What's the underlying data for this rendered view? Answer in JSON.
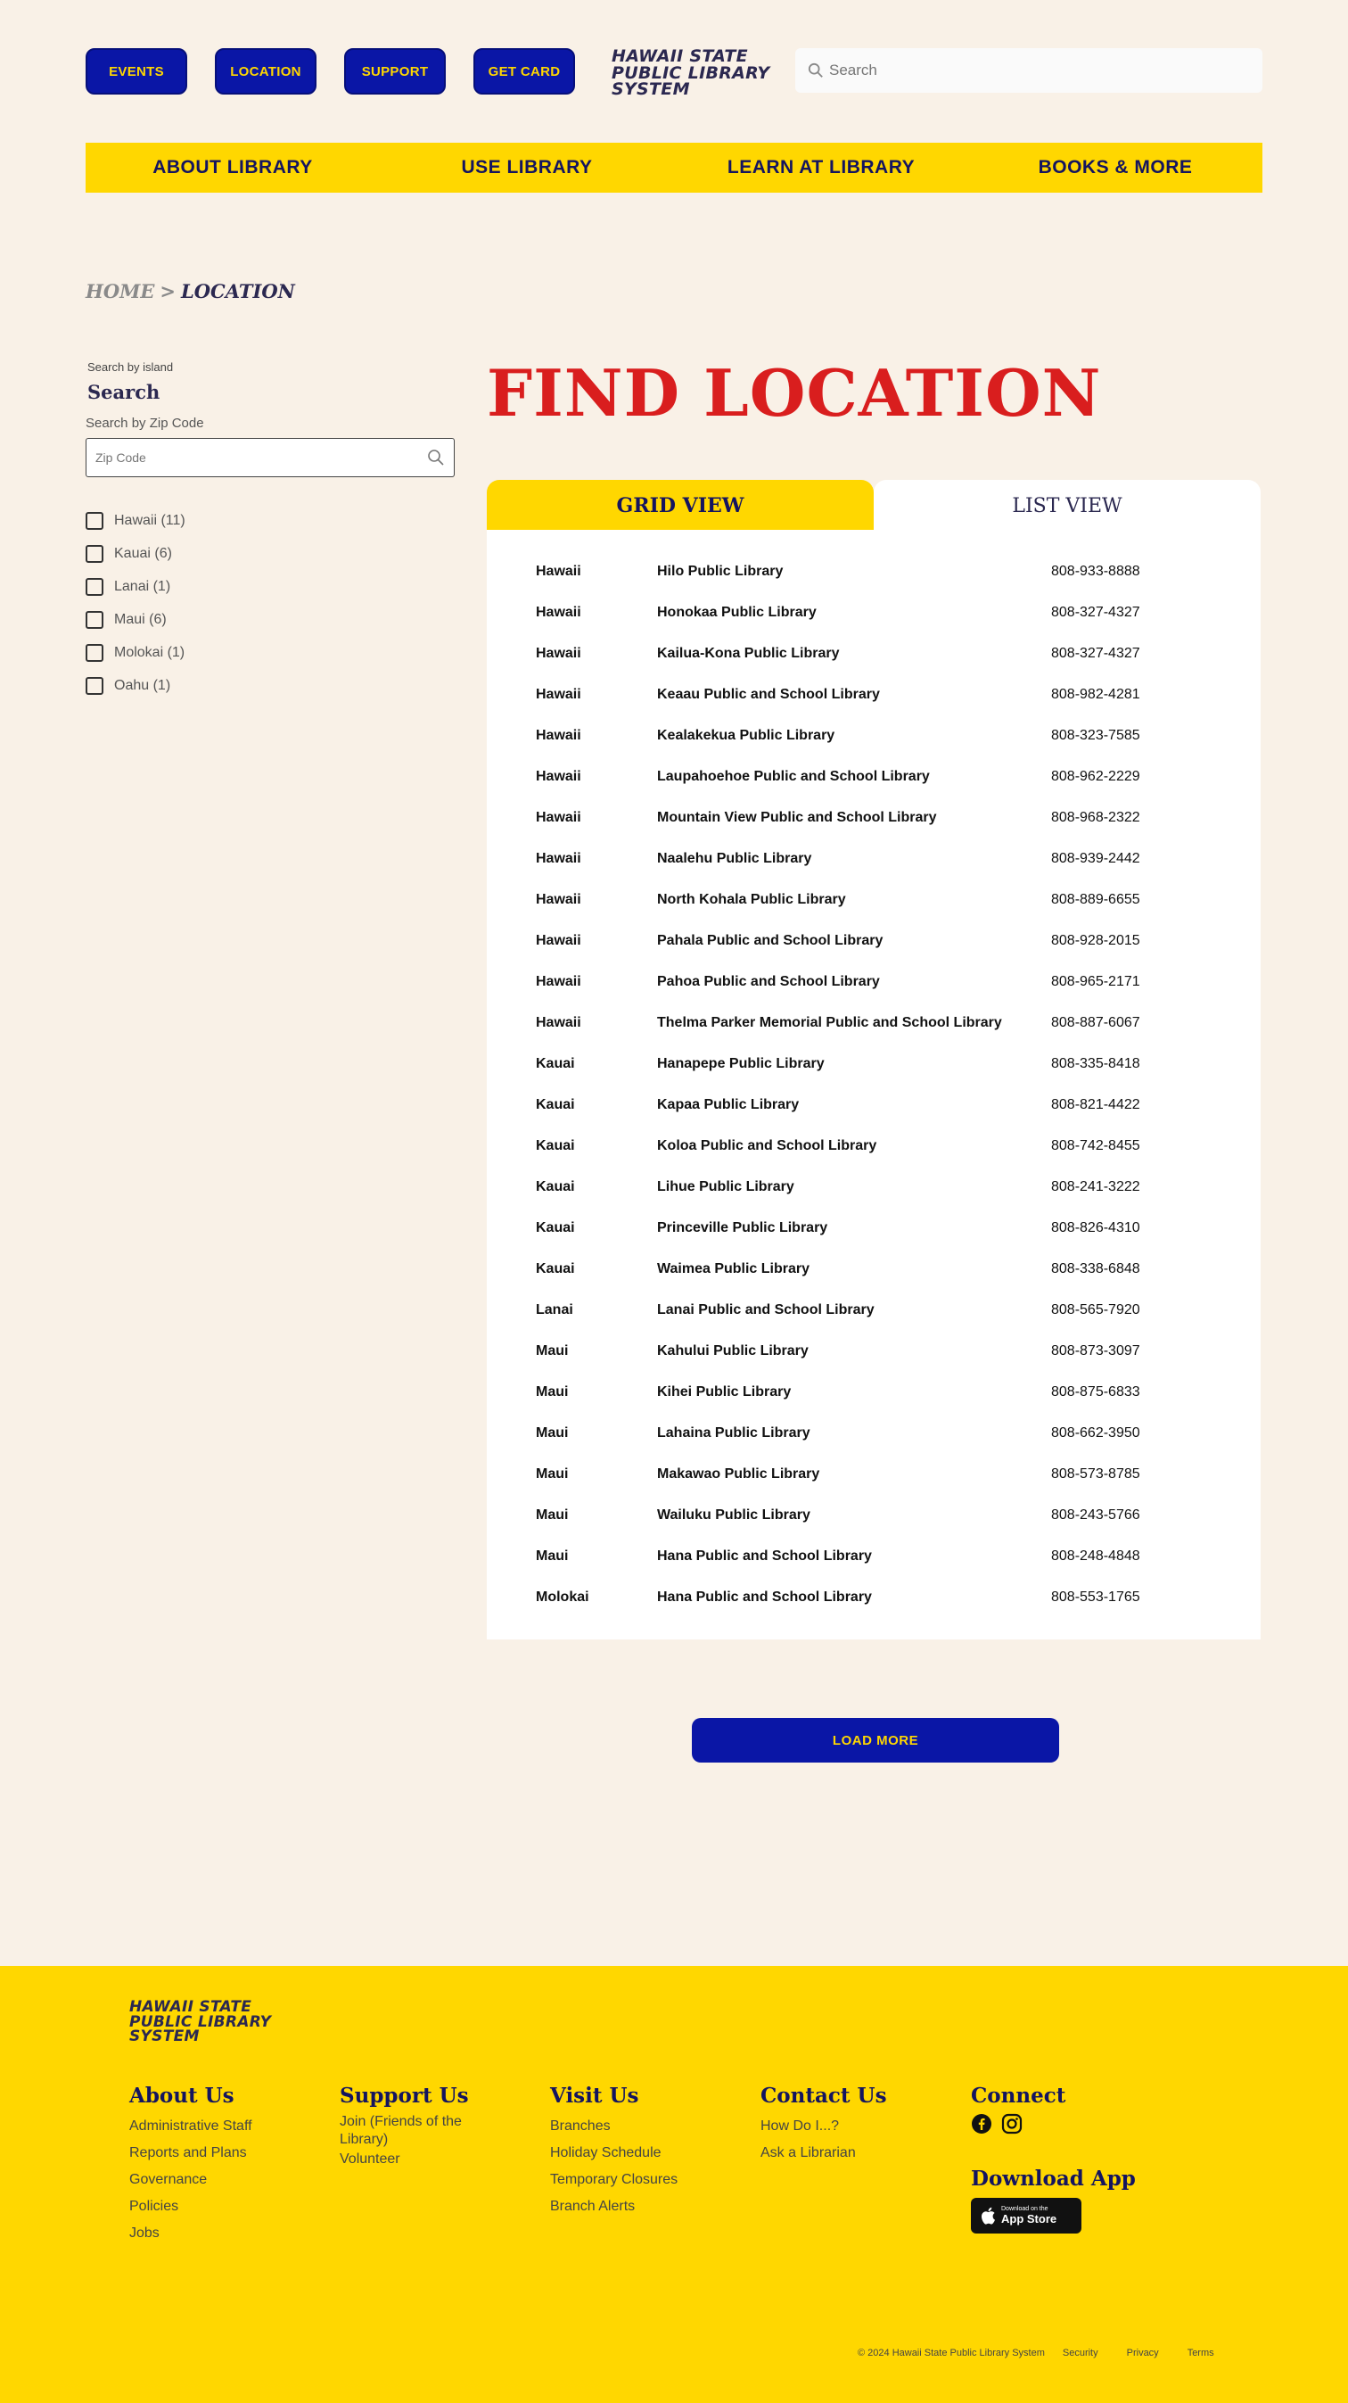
{
  "header": {
    "buttons": [
      "EVENTS",
      "LOCATION",
      "SUPPORT",
      "GET CARD"
    ],
    "logo_lines": [
      "HAWAII STATE",
      "PUBLIC LIBRARY",
      "SYSTEM"
    ],
    "search_placeholder": "Search"
  },
  "nav": [
    "ABOUT LIBRARY",
    "USE LIBRARY",
    "LEARN AT LIBRARY",
    "BOOKS & MORE"
  ],
  "breadcrumb": {
    "home": "HOME",
    "sep": ">",
    "current": "LOCATION"
  },
  "sidebar": {
    "hint": "Search by island",
    "title": "Search",
    "zip_label": "Search by Zip Code",
    "zip_placeholder": "Zip Code",
    "islands": [
      "Hawaii (11)",
      "Kauai (6)",
      "Lanai (1)",
      "Maui (6)",
      "Molokai (1)",
      "Oahu (1)"
    ]
  },
  "main": {
    "title": "FIND LOCATION",
    "tab_grid": "GRID VIEW",
    "tab_list": "LIST VIEW",
    "rows": [
      [
        "Hawaii",
        "Hilo Public Library",
        "808-933-8888"
      ],
      [
        "Hawaii",
        "Honokaa Public Library",
        "808-327-4327"
      ],
      [
        "Hawaii",
        "Kailua-Kona Public Library",
        "808-327-4327"
      ],
      [
        "Hawaii",
        "Keaau Public and School Library",
        "808-982-4281"
      ],
      [
        "Hawaii",
        "Kealakekua Public Library",
        "808-323-7585"
      ],
      [
        "Hawaii",
        "Laupahoehoe Public and School Library",
        "808-962-2229"
      ],
      [
        "Hawaii",
        "Mountain View Public and School Library",
        "808-968-2322"
      ],
      [
        "Hawaii",
        "Naalehu Public Library",
        "808-939-2442"
      ],
      [
        "Hawaii",
        "North Kohala Public Library",
        "808-889-6655"
      ],
      [
        "Hawaii",
        "Pahala Public and School Library",
        "808-928-2015"
      ],
      [
        "Hawaii",
        "Pahoa Public and School Library",
        "808-965-2171"
      ],
      [
        "Hawaii",
        "Thelma Parker Memorial Public and School Library",
        "808-887-6067"
      ],
      [
        "Kauai",
        "Hanapepe Public Library",
        "808-335-8418"
      ],
      [
        "Kauai",
        "Kapaa Public Library",
        "808-821-4422"
      ],
      [
        "Kauai",
        "Koloa Public and School Library",
        "808-742-8455"
      ],
      [
        "Kauai",
        "Lihue Public Library",
        "808-241-3222"
      ],
      [
        "Kauai",
        "Princeville Public Library",
        "808-826-4310"
      ],
      [
        "Kauai",
        "Waimea Public Library",
        "808-338-6848"
      ],
      [
        "Lanai",
        "Lanai Public and School Library",
        "808-565-7920"
      ],
      [
        "Maui",
        "Kahului Public Library",
        "808-873-3097"
      ],
      [
        "Maui",
        "Kihei Public Library",
        "808-875-6833"
      ],
      [
        "Maui",
        "Lahaina Public Library",
        "808-662-3950"
      ],
      [
        "Maui",
        "Makawao Public Library",
        "808-573-8785"
      ],
      [
        "Maui",
        "Wailuku Public Library",
        "808-243-5766"
      ],
      [
        "Maui",
        "Hana Public and School Library",
        "808-248-4848"
      ],
      [
        "Molokai",
        "Hana Public and School Library",
        "808-553-1765"
      ]
    ],
    "load_more": "LOAD MORE"
  },
  "footer": {
    "logo_lines": [
      "HAWAII STATE",
      "PUBLIC LIBRARY",
      "SYSTEM"
    ],
    "about": {
      "title": "About Us",
      "links": [
        "Administrative Staff",
        "Reports and Plans",
        "Governance",
        "Policies",
        "Jobs"
      ]
    },
    "support": {
      "title": "Support Us",
      "links": [
        "Join (Friends of the Library)",
        "Volunteer"
      ]
    },
    "visit": {
      "title": "Visit Us",
      "links": [
        "Branches",
        "Holiday Schedule",
        "Temporary Closures",
        "Branch Alerts"
      ]
    },
    "contact": {
      "title": "Contact Us",
      "links": [
        "How Do I...?",
        "Ask a Librarian"
      ]
    },
    "connect": {
      "title": "Connect",
      "icons": [
        "facebook-icon",
        "instagram-icon"
      ]
    },
    "download": {
      "title": "Download App",
      "badge_small": "Download on the",
      "badge_big": "App Store"
    },
    "copyright": "© 2024 Hawaii State Public Library System",
    "legal": [
      "Security",
      "Privacy",
      "Terms"
    ]
  },
  "colors": {
    "accent_yellow": "#ffd700",
    "brand_blue": "#0a16a6",
    "title_red": "#d91e1e",
    "background": "#f9f1e7"
  }
}
